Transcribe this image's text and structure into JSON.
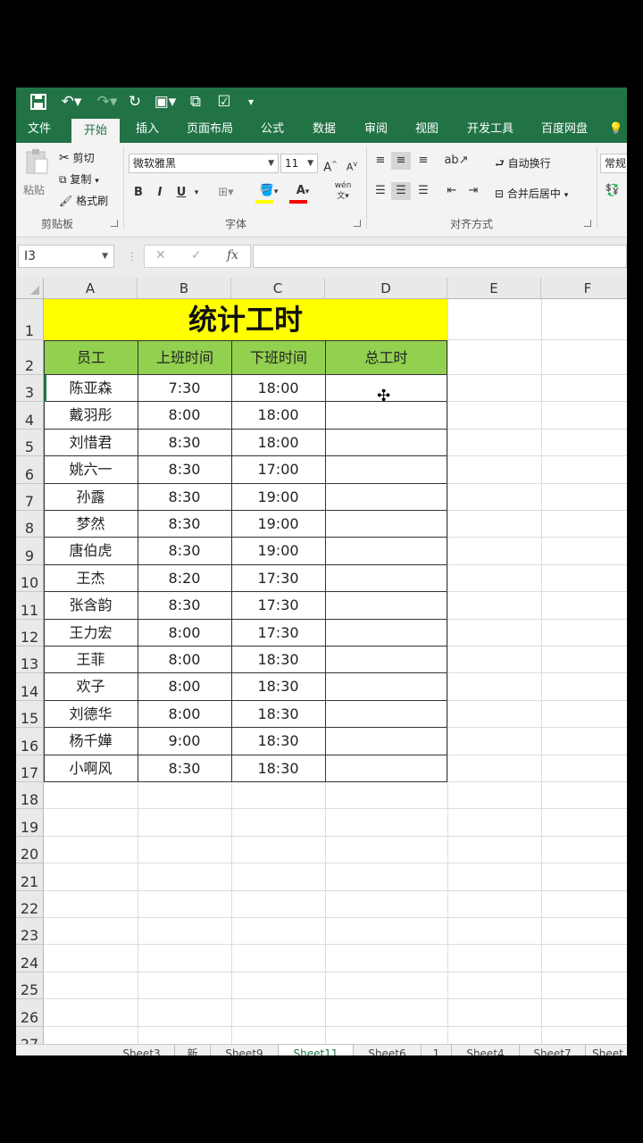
{
  "colors": {
    "ribbon_green": "#217346",
    "title_fill": "#ffff00",
    "header_fill": "#92d050"
  },
  "qat": {
    "save_icon": "save-icon",
    "undo_icon": "undo-icon",
    "redo_icon": "redo-icon",
    "refresh_icon": "refresh-icon"
  },
  "tabs": [
    "文件",
    "开始",
    "插入",
    "页面布局",
    "公式",
    "数据",
    "审阅",
    "视图",
    "开发工具",
    "百度网盘"
  ],
  "ribbon": {
    "paste": "粘贴",
    "cut": "剪切",
    "copy": "复制",
    "format_painter": "格式刷",
    "clipboard_group": "剪贴板",
    "font_name": "微软雅黑",
    "font_size": "11",
    "grow_font": "A",
    "shrink_font": "A",
    "bold": "B",
    "italic": "I",
    "underline": "U",
    "font_group": "字体",
    "phonetic": "wén",
    "wrap_text": "自动换行",
    "merge_center": "合并后居中",
    "align_group": "对齐方式",
    "number_format": "常规"
  },
  "formula_bar": {
    "name_box": "I3",
    "cancel": "✕",
    "enter": "✓",
    "fx": "fx",
    "value": ""
  },
  "columns": [
    "A",
    "B",
    "C",
    "D",
    "E",
    "F"
  ],
  "rows": [
    "1",
    "2",
    "3",
    "4",
    "5",
    "6",
    "7",
    "8",
    "9",
    "10",
    "11",
    "12",
    "13",
    "14",
    "15",
    "16",
    "17",
    "18",
    "19",
    "20",
    "21",
    "22",
    "23",
    "24",
    "25",
    "26",
    "27"
  ],
  "sheet": {
    "title": "统计工时",
    "headers": [
      "员工",
      "上班时间",
      "下班时间",
      "总工时"
    ],
    "records": [
      [
        "陈亚森",
        "7:30",
        "18:00",
        ""
      ],
      [
        "戴羽彤",
        "8:00",
        "18:00",
        ""
      ],
      [
        "刘惜君",
        "8:30",
        "18:00",
        ""
      ],
      [
        "姚六一",
        "8:30",
        "17:00",
        ""
      ],
      [
        "孙露",
        "8:30",
        "19:00",
        ""
      ],
      [
        "梦然",
        "8:30",
        "19:00",
        ""
      ],
      [
        "唐伯虎",
        "8:30",
        "19:00",
        ""
      ],
      [
        "王杰",
        "8:20",
        "17:30",
        ""
      ],
      [
        "张含韵",
        "8:30",
        "17:30",
        ""
      ],
      [
        "王力宏",
        "8:00",
        "17:30",
        ""
      ],
      [
        "王菲",
        "8:00",
        "18:30",
        ""
      ],
      [
        "欢子",
        "8:00",
        "18:30",
        ""
      ],
      [
        "刘德华",
        "8:00",
        "18:30",
        ""
      ],
      [
        "杨千嬅",
        "9:00",
        "18:30",
        ""
      ],
      [
        "小啊风",
        "8:30",
        "18:30",
        ""
      ]
    ]
  },
  "sheet_tabs": [
    "Sheet3",
    "新",
    "Sheet9",
    "Sheet11",
    "Sheet6",
    "1",
    "Sheet4",
    "Sheet7",
    "Sheet"
  ],
  "active_sheet_index": 3
}
